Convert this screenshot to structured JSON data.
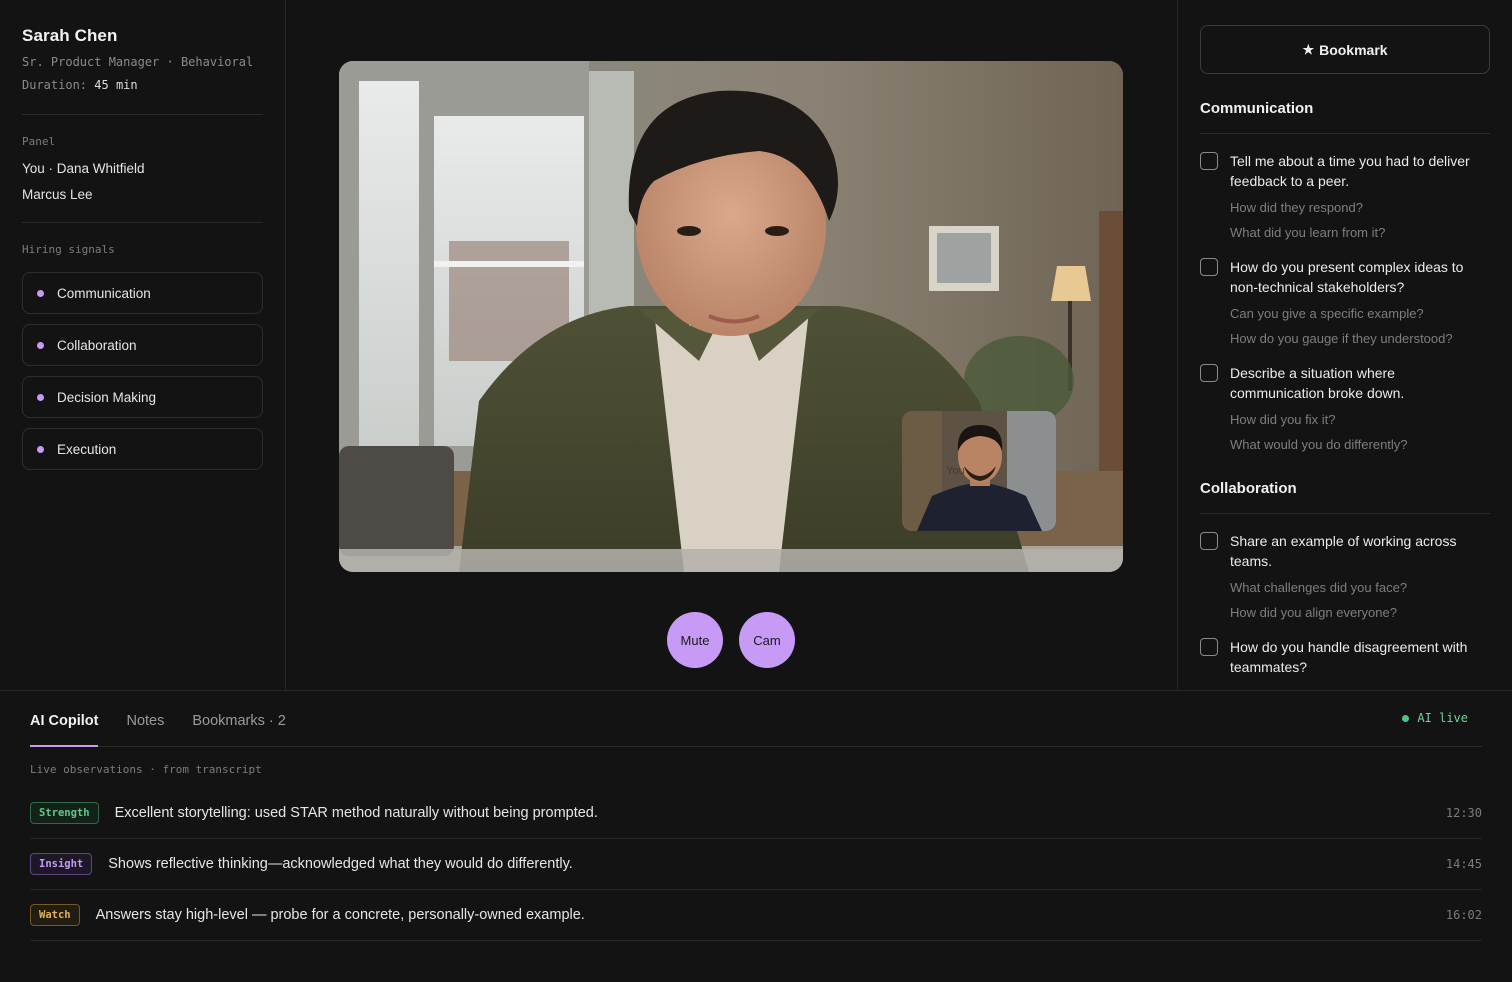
{
  "candidate": {
    "name": "Sarah Chen",
    "role_line": "Sr. Product Manager · Behavioral",
    "duration_label": "Duration:",
    "duration_value": "45 min"
  },
  "panel": {
    "label": "Panel",
    "members": [
      "You · Dana Whitfield",
      "Marcus Lee"
    ]
  },
  "signals": {
    "label": "Hiring signals",
    "items": [
      "Communication",
      "Collaboration",
      "Decision Making",
      "Execution"
    ]
  },
  "video": {
    "pip_label": "You",
    "controls": {
      "mute": "Mute",
      "cam": "Cam"
    }
  },
  "questions": {
    "bookmark_label": "Bookmark",
    "sections": [
      {
        "title": "Communication",
        "items": [
          {
            "q": "Tell me about a time you had to deliver feedback to a peer.",
            "followups": [
              "How did they respond?",
              "What did you learn from it?"
            ]
          },
          {
            "q": "How do you present complex ideas to non-technical stakeholders?",
            "followups": [
              "Can you give a specific example?",
              "How do you gauge if they understood?"
            ]
          },
          {
            "q": "Describe a situation where communication broke down.",
            "followups": [
              "How did you fix it?",
              "What would you do differently?"
            ]
          }
        ]
      },
      {
        "title": "Collaboration",
        "items": [
          {
            "q": "Share an example of working across teams.",
            "followups": [
              "What challenges did you face?",
              "How did you align everyone?"
            ]
          },
          {
            "q": "How do you handle disagreement with teammates?",
            "followups": []
          }
        ]
      }
    ]
  },
  "bottom": {
    "tabs": [
      "AI Copilot",
      "Notes",
      "Bookmarks · 2"
    ],
    "active_tab": 0,
    "live_label": "AI live",
    "caption": "Live observations · from transcript",
    "observations": [
      {
        "tag": "Strength",
        "text": "Excellent storytelling: used STAR method naturally without being prompted.",
        "time": "12:30"
      },
      {
        "tag": "Insight",
        "text": "Shows reflective thinking—acknowledged what they would do differently.",
        "time": "14:45"
      },
      {
        "tag": "Watch",
        "text": "Answers stay high-level — probe for a concrete, personally-owned example.",
        "time": "16:02"
      }
    ]
  },
  "colors": {
    "accent": "#c79bf5",
    "background": "#131313",
    "live": "#4cc685"
  }
}
